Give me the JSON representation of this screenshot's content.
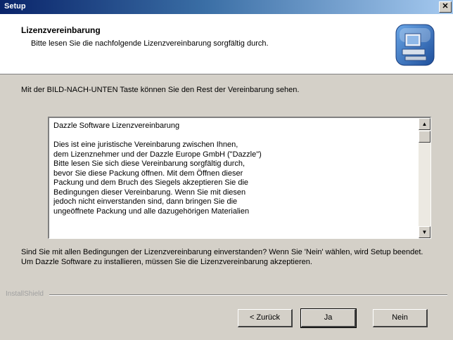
{
  "window": {
    "title": "Setup"
  },
  "header": {
    "title": "Lizenzvereinbarung",
    "subtitle": "Bitte lesen Sie die nachfolgende Lizenzvereinbarung sorgfältig durch."
  },
  "instruction": "Mit der BILD-NACH-UNTEN Taste können Sie den Rest der Vereinbarung sehen.",
  "license": {
    "text": "Dazzle Software Lizenzvereinbarung\n\nDies ist eine juristische Vereinbarung zwischen Ihnen,\ndem Lizenznehmer und der Dazzle Europe GmbH (\"Dazzle\")\nBitte lesen Sie sich diese Vereinbarung sorgfältig durch,\nbevor Sie diese Packung öffnen. Mit dem Öffnen dieser\nPackung und dem Bruch des Siegels akzeptieren Sie die\nBedingungen dieser Vereinbarung. Wenn Sie mit diesen\njedoch nicht einverstanden sind, dann bringen Sie die\nungeöffnete Packung und alle dazugehörigen Materialien"
  },
  "question": "Sind Sie mit allen Bedingungen der Lizenzvereinbarung einverstanden? Wenn Sie 'Nein' wählen, wird Setup beendet. Um Dazzle Software zu installieren, müssen Sie die Lizenzvereinbarung akzeptieren.",
  "branding": "InstallShield",
  "buttons": {
    "back": "< Zurück",
    "yes": "Ja",
    "no": "Nein"
  },
  "icons": {
    "close": "close-icon",
    "setup": "computer-setup-icon",
    "scroll_up": "scroll-up-icon",
    "scroll_down": "scroll-down-icon"
  }
}
